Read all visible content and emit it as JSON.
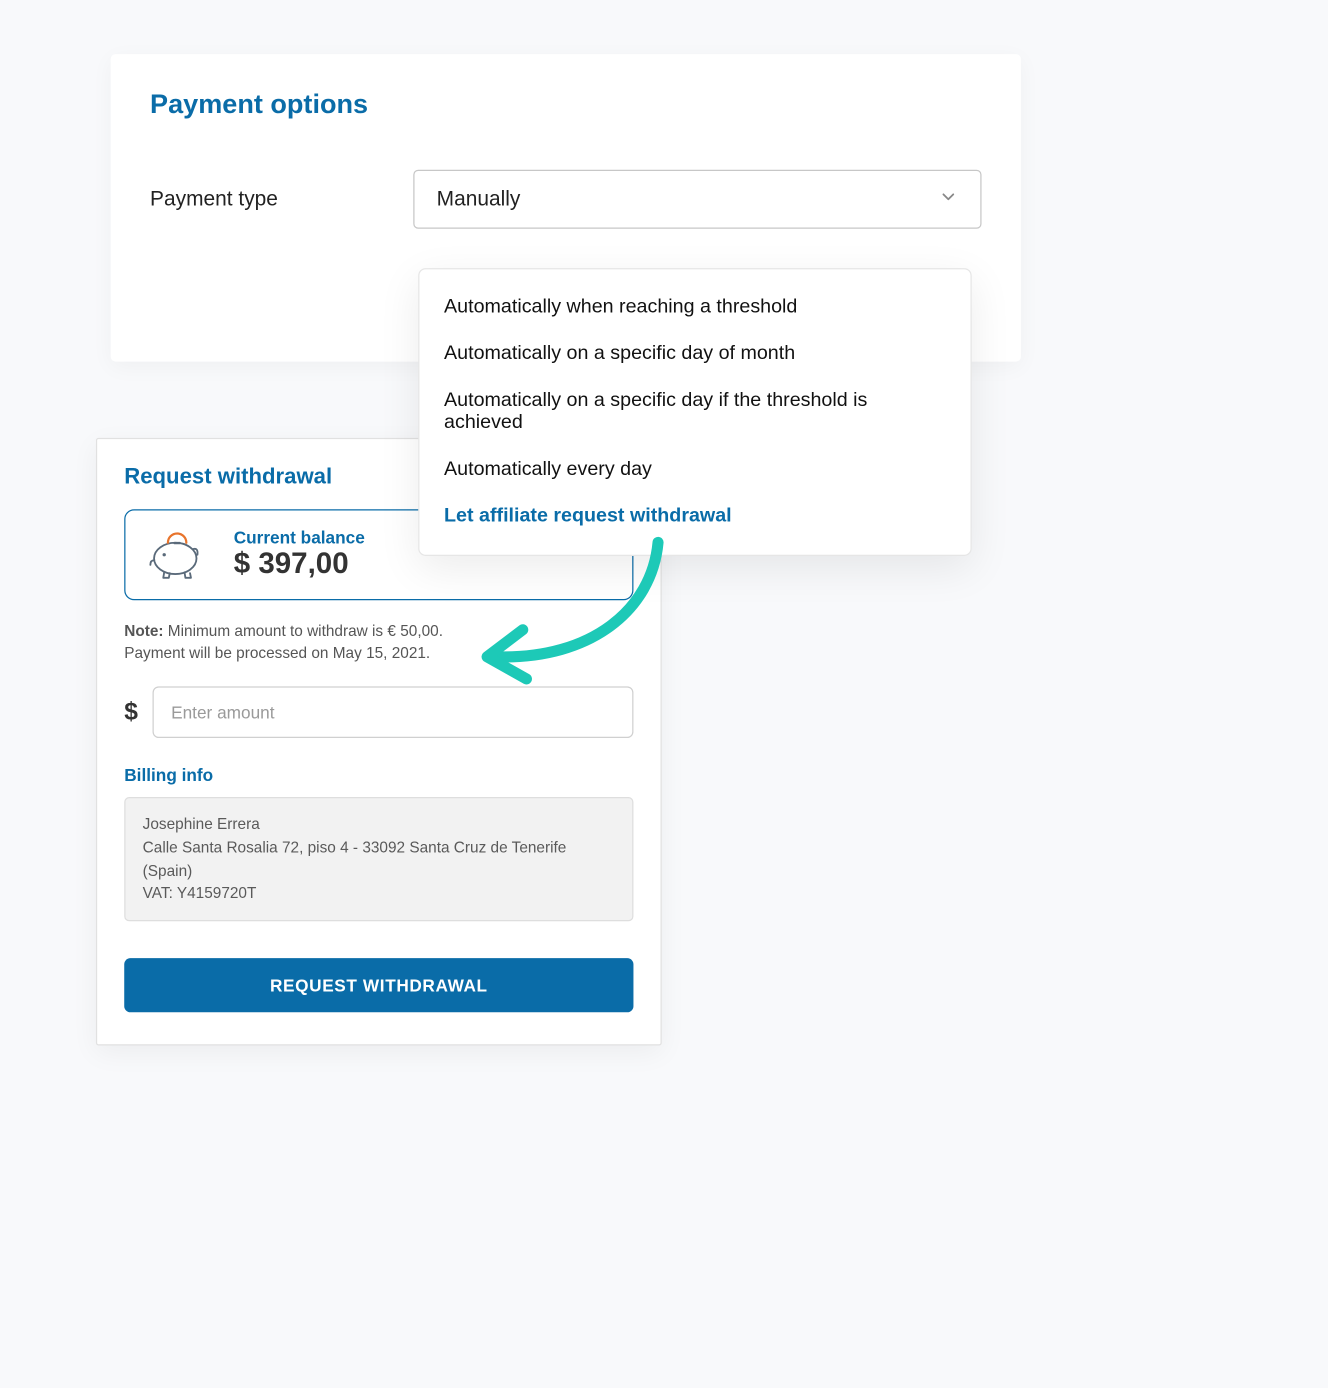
{
  "paymentOptions": {
    "title": "Payment options",
    "typeLabel": "Payment type",
    "selectedValue": "Manually",
    "dropdown": [
      "Automatically when reaching a threshold",
      "Automatically on a specific day of month",
      "Automatically on a specific day if the threshold is achieved",
      "Automatically every day",
      "Let affiliate request withdrawal"
    ]
  },
  "withdrawal": {
    "title": "Request withdrawal",
    "balanceLabel": "Current balance",
    "balanceAmount": "$ 397,00",
    "noteLabel": "Note:",
    "noteText": " Minimum amount to withdraw is € 50,00.",
    "processedText": "Payment will be processed on May 15, 2021.",
    "currencySymbol": "$",
    "amountPlaceholder": "Enter amount",
    "billingTitle": "Billing info",
    "billingName": "Josephine Errera",
    "billingAddress": "Calle Santa Rosalia 72, piso 4 - 33092 Santa Cruz de Tenerife (Spain)",
    "billingVat": "VAT: Y4159720T",
    "buttonLabel": "REQUEST WITHDRAWAL"
  },
  "colors": {
    "brand": "#0a6ca8",
    "arrow": "#1dc9b7"
  }
}
